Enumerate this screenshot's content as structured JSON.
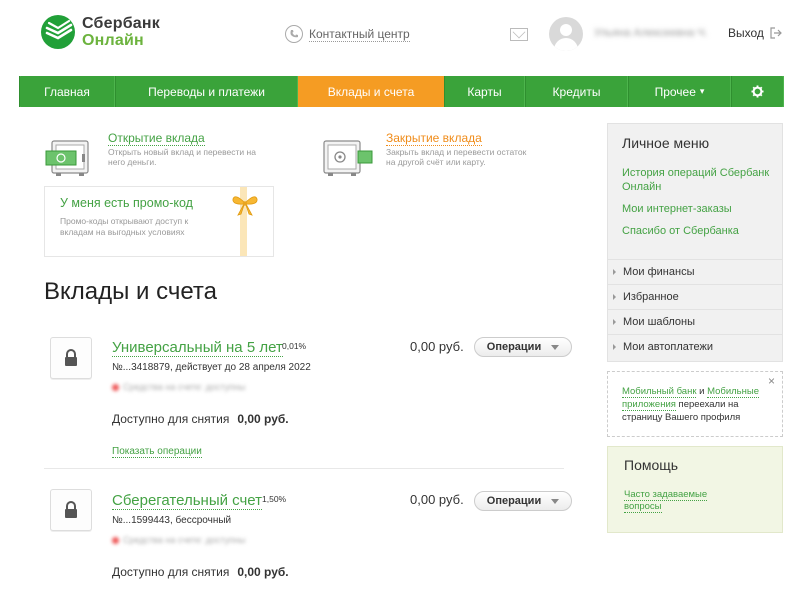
{
  "header": {
    "logo_line1": "Сбербанк",
    "logo_line2": "Онлайн",
    "contact_center": "Контактный центр",
    "user_name": "Ульяна Алексеевна Ч.",
    "logout": "Выход"
  },
  "nav": {
    "items": [
      {
        "label": "Главная"
      },
      {
        "label": "Переводы и платежи"
      },
      {
        "label": "Вклады и счета"
      },
      {
        "label": "Карты"
      },
      {
        "label": "Кредиты"
      },
      {
        "label": "Прочее"
      }
    ],
    "more_caret": "▾",
    "active_index": 2
  },
  "actions": {
    "open": {
      "title": "Открытие вклада",
      "desc": "Открыть новый вклад и перевести на него деньги."
    },
    "close": {
      "title": "Закрытие вклада",
      "desc": "Закрыть вклад и перевести остаток на другой счёт или карту."
    }
  },
  "promo": {
    "title": "У меня есть промо-код",
    "desc": "Промо-коды открывают доступ к вкладам на выгодных условиях"
  },
  "page_title": "Вклады и счета",
  "accounts": [
    {
      "name": "Универсальный на 5 лет",
      "rate": "0,01%",
      "number": "№...3418879, действует до 28 апреля 2022",
      "blurred": "Средства на счете: доступны",
      "available_label": "Доступно для снятия",
      "available_value": "0,00 руб.",
      "amount": "0,00 руб.",
      "ops_label": "Операции",
      "show_ops": "Показать операции"
    },
    {
      "name": "Сберегательный счет",
      "rate": "1,50%",
      "number": "№...1599443, бессрочный",
      "blurred": "Средства на счете: доступны",
      "available_label": "Доступно для снятия",
      "available_value": "0,00 руб.",
      "amount": "0,00 руб.",
      "ops_label": "Операции"
    }
  ],
  "sidebar": {
    "title": "Личное меню",
    "links": [
      "История операций Сбербанк Онлайн",
      "Мои интернет-заказы",
      "Спасибо от Сбербанка"
    ],
    "items": [
      "Мои финансы",
      "Избранное",
      "Мои шаблоны",
      "Мои автоплатежи"
    ]
  },
  "notice": {
    "link1": "Мобильный банк",
    "and": " и ",
    "link2": "Мобильные приложения",
    "rest": " переехали на страницу Вашего профиля",
    "close": "×"
  },
  "help": {
    "title": "Помощь",
    "link": "Часто задаваемые вопросы"
  },
  "colors": {
    "brand_green": "#3aa33a",
    "active_orange": "#f59c23",
    "link_green": "#44a244"
  }
}
